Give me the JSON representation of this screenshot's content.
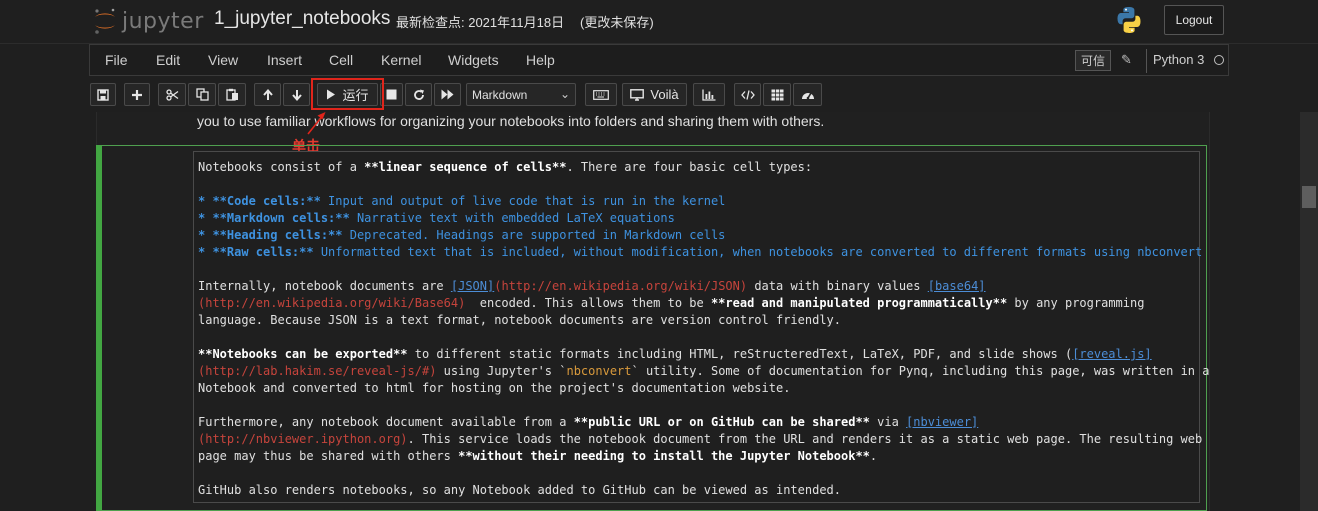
{
  "header": {
    "logo_text": "jupyter",
    "notebook_name": "1_jupyter_notebooks",
    "checkpoint": "最新检查点: 2021年11月18日",
    "autosave_status": "(更改未保存)",
    "logout_label": "Logout"
  },
  "menubar": {
    "items": [
      "File",
      "Edit",
      "View",
      "Insert",
      "Cell",
      "Kernel",
      "Widgets",
      "Help"
    ],
    "trusted_label": "可信",
    "kernel_name": "Python 3"
  },
  "toolbar": {
    "run_label": "运行",
    "cell_type": "Markdown",
    "voila_label": "Voilà"
  },
  "annotation": {
    "label": "单击",
    "color": "#e0251b"
  },
  "prev_cell_text": "you to use familiar workflows for organizing your notebooks into folders and sharing them with others.",
  "cell": {
    "l1a": "Notebooks consist of a ",
    "l1b": "**linear sequence of cells**",
    "l1c": ". There are four basic cell types:",
    "bullets": [
      {
        "head": "* **Code cells:**",
        "body": " Input and output of live code that is run in the kernel"
      },
      {
        "head": "* **Markdown cells:**",
        "body": " Narrative text with embedded LaTeX equations"
      },
      {
        "head": "* **Heading cells:**",
        "body": " Deprecated. Headings are supported in Markdown cells"
      },
      {
        "head": "* **Raw cells:**",
        "body": " Unformatted text that is included, without modification, when notebooks are converted to different formats using nbconvert"
      }
    ],
    "p2": {
      "a": "Internally, notebook documents are ",
      "link1": "[JSON]",
      "url1": "(http://en.wikipedia.org/wiki/JSON)",
      "b": " data with binary values ",
      "link2": "[base64]",
      "url2": "(http://en.wikipedia.org/wiki/Base64)",
      "c": "  encoded. This allows them to be ",
      "bold": "**read and manipulated programmatically**",
      "d": " by any programming",
      "e": "language. Because JSON is a text format, notebook documents are version control friendly."
    },
    "p3": {
      "bold": "**Notebooks can be exported**",
      "a": " to different static formats including HTML, reStructeredText, LaTeX, PDF, and slide shows (",
      "link": "[reveal.js]",
      "url": "(http://lab.hakim.se/reveal-js/#)",
      "b": " using Jupyter's `",
      "code": "nbconvert",
      "c": "` utility. Some of documentation for Pynq, including this page, was written in a",
      "d": "Notebook and converted to html for hosting on the project's documentation website."
    },
    "p4": {
      "a": "Furthermore, any notebook document available from a ",
      "bold1": "**public URL or on GitHub can be shared**",
      "b": " via ",
      "link": "[nbviewer]",
      "url": "(http://nbviewer.ipython.org)",
      "c": ". This service loads the notebook document from the URL and renders it as a static web page. The resulting web",
      "d": "page may thus be shared with others ",
      "bold2": "**without their needing to install the Jupyter Notebook**",
      "e": "."
    },
    "p5": "GitHub also renders notebooks, so any Notebook added to GitHub can be viewed as intended."
  }
}
